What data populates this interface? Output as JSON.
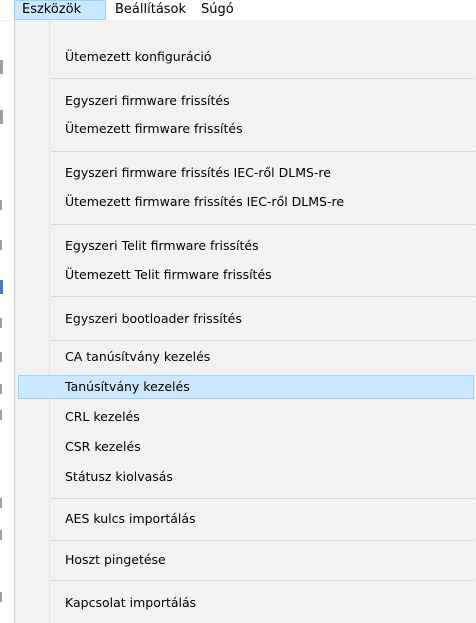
{
  "menubar": {
    "items": [
      {
        "label": "Eszközök"
      },
      {
        "label": "Beállítások"
      },
      {
        "label": "Súgó"
      }
    ]
  },
  "menu": {
    "items": [
      {
        "label": "Ütemezett konfiguráció"
      },
      {
        "label": "Egyszeri firmware frissítés"
      },
      {
        "label": "Ütemezett firmware frissítés"
      },
      {
        "label": "Egyszeri firmware frissítés IEC-ről DLMS-re"
      },
      {
        "label": "Ütemezett firmware frissítés IEC-ről DLMS-re"
      },
      {
        "label": "Egyszeri Telit firmware frissítés"
      },
      {
        "label": "Ütemezett Telit firmware frissítés"
      },
      {
        "label": "Egyszeri bootloader frissítés"
      },
      {
        "label": "CA tanúsítvány kezelés"
      },
      {
        "label": "Tanúsítvány kezelés"
      },
      {
        "label": "CRL kezelés"
      },
      {
        "label": "CSR kezelés"
      },
      {
        "label": "Státusz kiolvasás"
      },
      {
        "label": "AES kulcs importálás"
      },
      {
        "label": "Hoszt pingetése"
      },
      {
        "label": "Kapcsolat importálás"
      }
    ],
    "highlighted_item": "Tanúsítvány kezelés"
  },
  "colors": {
    "menu_background": "#f2f2f2",
    "highlight_background": "#cce8ff",
    "highlight_border": "#99d1ff",
    "separator": "#d7d7d7"
  }
}
